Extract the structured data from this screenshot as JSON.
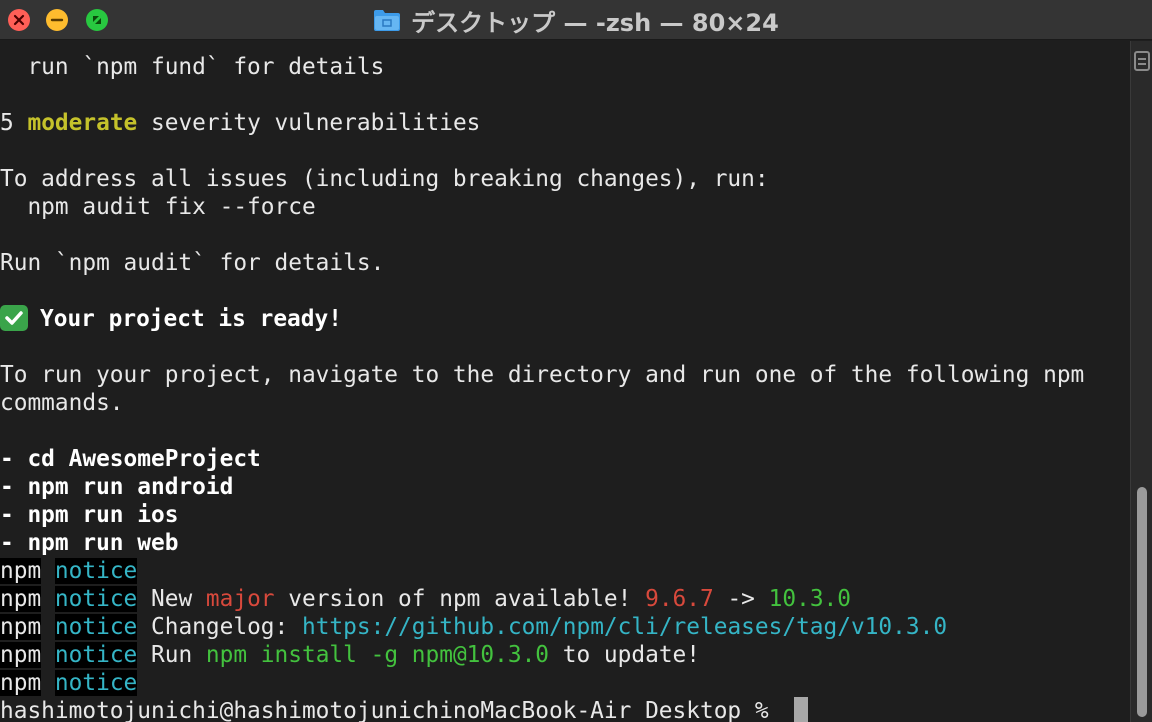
{
  "window": {
    "title": "デスクトップ — -zsh — 80×24",
    "buttons": [
      "close",
      "minimize",
      "zoom"
    ],
    "icon": "folder-icon"
  },
  "colors": {
    "background": "#1e1e1e",
    "titlebar": "#343434",
    "text": "#e8e8e8",
    "yellow": "#c5c22b",
    "cyan": "#35b5c6",
    "red": "#d8493c",
    "green": "#43c23e"
  },
  "terminal": {
    "fund_line": "  run `npm fund` for details",
    "vuln": {
      "count": "5",
      "severity": "moderate",
      "rest": " severity vulnerabilities"
    },
    "address_line": "To address all issues (including breaking changes), run:",
    "fix_cmd": "  npm audit fix --force",
    "audit_line": "Run `npm audit` for details.",
    "ready": "Your project is ready!",
    "run_intro_1": "To run your project, navigate to the directory and run one of the following npm",
    "run_intro_2": "commands.",
    "commands": [
      "- cd AwesomeProject",
      "- npm run android",
      "- npm run ios",
      "- npm run web"
    ],
    "npm_label": "npm",
    "notice_label": "notice",
    "notice_version": {
      "pre": " New ",
      "major": "major",
      "mid": " version of npm available! ",
      "old": "9.6.7",
      "arrow": " -> ",
      "new": "10.3.0"
    },
    "notice_changelog": {
      "pre": " Changelog: ",
      "url": "https://github.com/npm/cli/releases/tag/v10.3.0"
    },
    "notice_run": {
      "pre": " Run ",
      "cmd": "npm install -g npm@10.3.0",
      "post": " to update!"
    },
    "prompt": "hashimotojunichi@hashimotojunichinoMacBook-Air Desktop % "
  }
}
